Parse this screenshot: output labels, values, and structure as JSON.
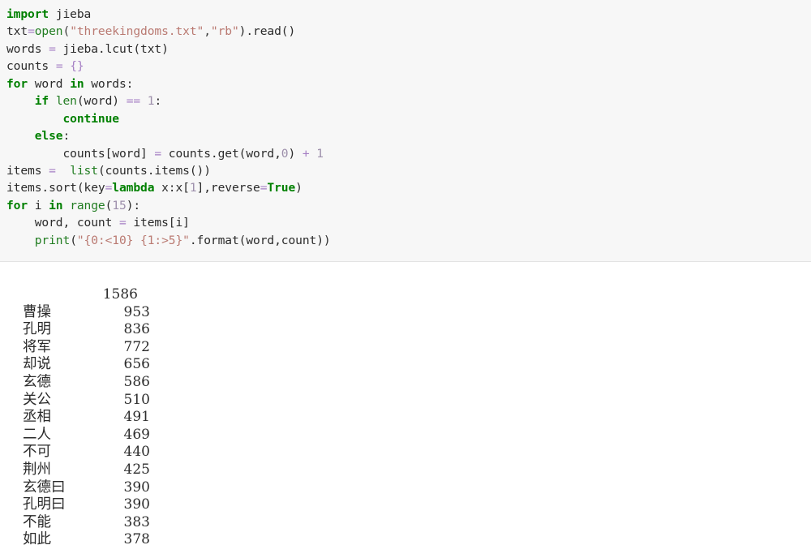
{
  "code_block": {
    "language": "python",
    "background_color": "#f7f7f7",
    "border_color": "#e3e3e3",
    "lines": [
      [
        {
          "t": "import",
          "c": "kw"
        },
        {
          "t": " jieba",
          "c": "pl"
        }
      ],
      [
        {
          "t": "txt",
          "c": "pl"
        },
        {
          "t": "=",
          "c": "op"
        },
        {
          "t": "open",
          "c": "bi"
        },
        {
          "t": "(",
          "c": "punc"
        },
        {
          "t": "\"threekingdoms.txt\"",
          "c": "str"
        },
        {
          "t": ",",
          "c": "punc"
        },
        {
          "t": "\"rb\"",
          "c": "str"
        },
        {
          "t": ").read()",
          "c": "pl"
        }
      ],
      [
        {
          "t": "words ",
          "c": "pl"
        },
        {
          "t": "=",
          "c": "op"
        },
        {
          "t": " jieba.lcut(txt)",
          "c": "pl"
        }
      ],
      [
        {
          "t": "counts ",
          "c": "pl"
        },
        {
          "t": "=",
          "c": "op"
        },
        {
          "t": " ",
          "c": "pl"
        },
        {
          "t": "{}",
          "c": "op"
        }
      ],
      [
        {
          "t": "for",
          "c": "kw"
        },
        {
          "t": " word ",
          "c": "pl"
        },
        {
          "t": "in",
          "c": "kw"
        },
        {
          "t": " words:",
          "c": "pl"
        }
      ],
      [
        {
          "t": "    ",
          "c": "pl"
        },
        {
          "t": "if",
          "c": "kw"
        },
        {
          "t": " ",
          "c": "pl"
        },
        {
          "t": "len",
          "c": "bi"
        },
        {
          "t": "(word) ",
          "c": "pl"
        },
        {
          "t": "==",
          "c": "op"
        },
        {
          "t": " ",
          "c": "pl"
        },
        {
          "t": "1",
          "c": "num"
        },
        {
          "t": ":",
          "c": "pl"
        }
      ],
      [
        {
          "t": "        ",
          "c": "pl"
        },
        {
          "t": "continue",
          "c": "kw"
        }
      ],
      [
        {
          "t": "    ",
          "c": "pl"
        },
        {
          "t": "else",
          "c": "kw"
        },
        {
          "t": ":",
          "c": "pl"
        }
      ],
      [
        {
          "t": "        counts[word] ",
          "c": "pl"
        },
        {
          "t": "=",
          "c": "op"
        },
        {
          "t": " counts.get(word,",
          "c": "pl"
        },
        {
          "t": "0",
          "c": "num"
        },
        {
          "t": ") ",
          "c": "pl"
        },
        {
          "t": "+",
          "c": "op"
        },
        {
          "t": " ",
          "c": "pl"
        },
        {
          "t": "1",
          "c": "num"
        }
      ],
      [
        {
          "t": "items ",
          "c": "pl"
        },
        {
          "t": "=",
          "c": "op"
        },
        {
          "t": "  ",
          "c": "pl"
        },
        {
          "t": "list",
          "c": "bi"
        },
        {
          "t": "(counts.items())",
          "c": "pl"
        }
      ],
      [
        {
          "t": "items.sort(key",
          "c": "pl"
        },
        {
          "t": "=",
          "c": "op"
        },
        {
          "t": "lambda",
          "c": "kw"
        },
        {
          "t": " x:x[",
          "c": "pl"
        },
        {
          "t": "1",
          "c": "num"
        },
        {
          "t": "],reverse",
          "c": "pl"
        },
        {
          "t": "=",
          "c": "op"
        },
        {
          "t": "True",
          "c": "kw"
        },
        {
          "t": ")",
          "c": "pl"
        }
      ],
      [
        {
          "t": "for",
          "c": "kw"
        },
        {
          "t": " i ",
          "c": "pl"
        },
        {
          "t": "in",
          "c": "kw"
        },
        {
          "t": " ",
          "c": "pl"
        },
        {
          "t": "range",
          "c": "bi"
        },
        {
          "t": "(",
          "c": "pl"
        },
        {
          "t": "15",
          "c": "num"
        },
        {
          "t": "):",
          "c": "pl"
        }
      ],
      [
        {
          "t": "    word, count ",
          "c": "pl"
        },
        {
          "t": "=",
          "c": "op"
        },
        {
          "t": " items[i]",
          "c": "pl"
        }
      ],
      [
        {
          "t": "    ",
          "c": "pl"
        },
        {
          "t": "print",
          "c": "bi"
        },
        {
          "t": "(",
          "c": "pl"
        },
        {
          "t": "\"{0:<10} {1:>5}\"",
          "c": "str"
        },
        {
          "t": ".format(word,count))",
          "c": "pl"
        }
      ]
    ]
  },
  "output": {
    "rows": [
      {
        "word": "",
        "count": "1586",
        "indent": "first"
      },
      {
        "word": "曹操",
        "count": "953"
      },
      {
        "word": "孔明",
        "count": "836"
      },
      {
        "word": "将军",
        "count": "772"
      },
      {
        "word": "却说",
        "count": "656"
      },
      {
        "word": "玄德",
        "count": "586"
      },
      {
        "word": "关公",
        "count": "510"
      },
      {
        "word": "丞相",
        "count": "491"
      },
      {
        "word": "二人",
        "count": "469"
      },
      {
        "word": "不可",
        "count": "440"
      },
      {
        "word": "荆州",
        "count": "425"
      },
      {
        "word": "玄德曰",
        "count": "390"
      },
      {
        "word": "孔明曰",
        "count": "390"
      },
      {
        "word": "不能",
        "count": "383"
      },
      {
        "word": "如此",
        "count": "378"
      }
    ]
  }
}
